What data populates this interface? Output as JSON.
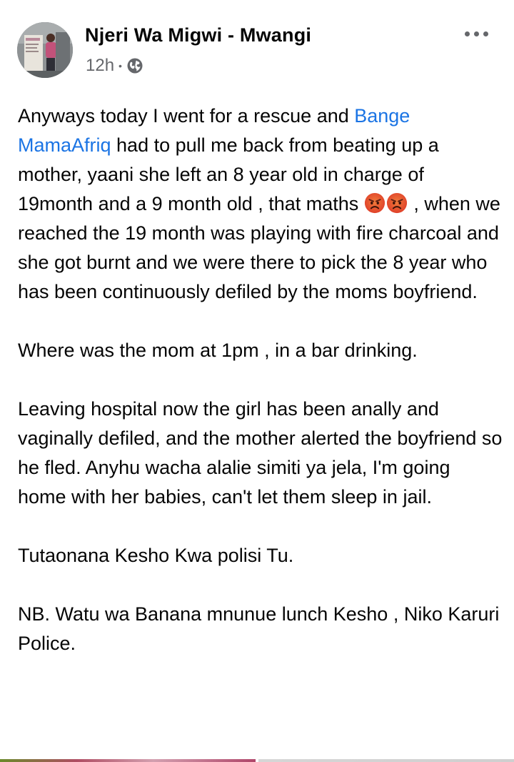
{
  "post": {
    "author": "Njeri Wa Migwi - Mwangi",
    "time": "12h",
    "separator": "•",
    "audience_icon": "globe-icon",
    "more_icon": "more-options-icon",
    "mention_text": "Bange MamaAfriq",
    "mention_color": "#1b74e4",
    "emoji_icon": "angry-face-icon",
    "p1": {
      "before_mention": "Anyways today I went for a rescue and ",
      "after_mention": "  had to pull me back from beating up a mother, yaani she left an 8 year old in charge of 19month and a 9 month old , that maths ",
      "after_emoji": " , when we reached the 19 month was playing with fire charcoal and she got burnt and we were there to pick the 8 year who has been continuously defiled by the moms boyfriend."
    },
    "p2": "Where was the mom at 1pm , in a bar drinking.",
    "p3": "Leaving hospital now the girl has been anally and vaginally defiled, and the mother alerted the boyfriend so he fled. Anyhu wacha alalie simiti ya jela, I'm going home with her babies, can't let them sleep in jail.",
    "p4": "Tutaonana Kesho Kwa polisi Tu.",
    "p5": "NB. Watu wa Banana mnunue lunch Kesho , Niko Karuri Police."
  },
  "colors": {
    "text": "#050505",
    "secondary": "#65676b",
    "link": "#1b74e4"
  }
}
